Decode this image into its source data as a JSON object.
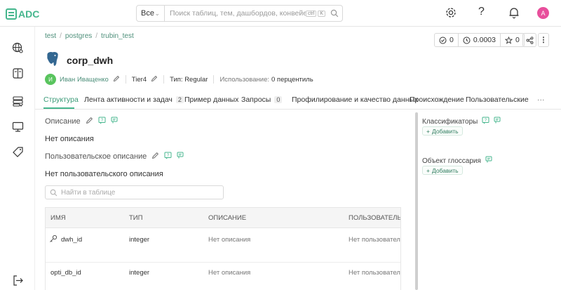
{
  "app": {
    "logo_text": "ADC"
  },
  "search": {
    "scope": "Все",
    "placeholder": "Поиск таблиц, тем, дашбордов, конвейеров, м...",
    "kbd_1": "ctrl",
    "kbd_2": "K"
  },
  "user": {
    "avatar_letter": "A"
  },
  "breadcrumbs": [
    "test",
    "postgres",
    "trubin_test"
  ],
  "actions": {
    "tasks_count": "0",
    "version": "0.0003",
    "stars": "0"
  },
  "entity": {
    "title": "corp_dwh",
    "owner_initial": "И",
    "owner_name": "Иван Иващенко",
    "tier": "Tier4",
    "type_text": "Тип: Regular",
    "usage_label": "Использование:",
    "usage_value": "0 перцентиль"
  },
  "tabs": [
    {
      "label": "Структура"
    },
    {
      "label": "Лента активности и задач",
      "count": "2"
    },
    {
      "label": "Пример данных"
    },
    {
      "label": "Запросы",
      "count": "0"
    },
    {
      "label": "Профилирование и качество данных"
    },
    {
      "label": "Происхождение"
    },
    {
      "label": "Пользовательские атр"
    }
  ],
  "description": {
    "label": "Описание",
    "value": "Нет описания"
  },
  "custom_description": {
    "label": "Пользовательское описание",
    "value": "Нет пользовательского описания"
  },
  "table_search": {
    "placeholder": "Найти в таблице"
  },
  "table": {
    "headers": [
      "ИМЯ",
      "ТИП",
      "ОПИСАНИЕ",
      "ПОЛЬЗОВАТЕЛЬ"
    ],
    "rows": [
      {
        "name": "dwh_id",
        "type": "integer",
        "description": "Нет описания",
        "custom": "Нет пользовател"
      },
      {
        "name": "opti_db_id",
        "type": "integer",
        "description": "Нет описания",
        "custom": "Нет пользовател"
      }
    ]
  },
  "right_panel": {
    "classifiers_label": "Классификаторы",
    "add_label": "Добавить",
    "glossary_label": "Объект глоссария"
  },
  "colors": {
    "accent": "#45b68d",
    "link": "#4d8f7a",
    "owner_avatar": "#59c45e",
    "user_avatar": "#e84f9c"
  }
}
